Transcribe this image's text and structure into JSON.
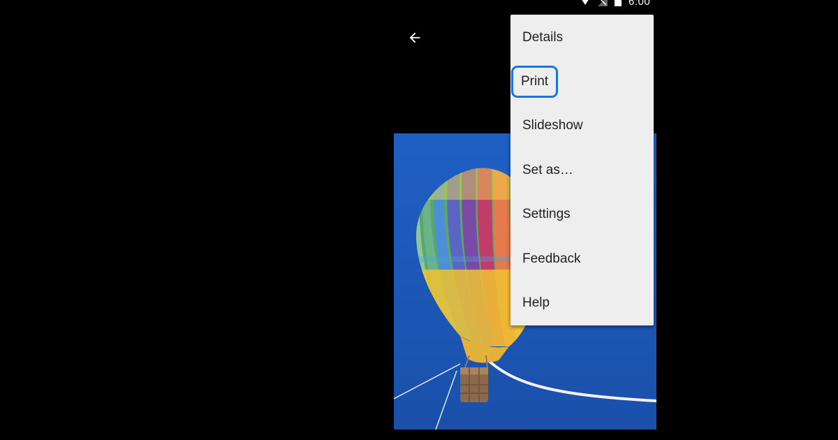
{
  "status_bar": {
    "time": "6:00",
    "icons": [
      "wifi-icon",
      "signal-icon",
      "battery-icon"
    ]
  },
  "toolbar": {
    "back_icon": "arrow-left-icon"
  },
  "menu": {
    "items": [
      {
        "label": "Details"
      },
      {
        "label": "Print",
        "focused": true
      },
      {
        "label": "Slideshow"
      },
      {
        "label": "Set as…"
      },
      {
        "label": "Settings"
      },
      {
        "label": "Feedback"
      },
      {
        "label": "Help"
      }
    ]
  },
  "photo": {
    "subject": "hot-air-balloon-image"
  },
  "colors": {
    "background": "#000000",
    "menu_background": "#eeeeee",
    "menu_text": "#212121",
    "focus_ring": "#1a73e8",
    "sky": "#1a55b8"
  }
}
